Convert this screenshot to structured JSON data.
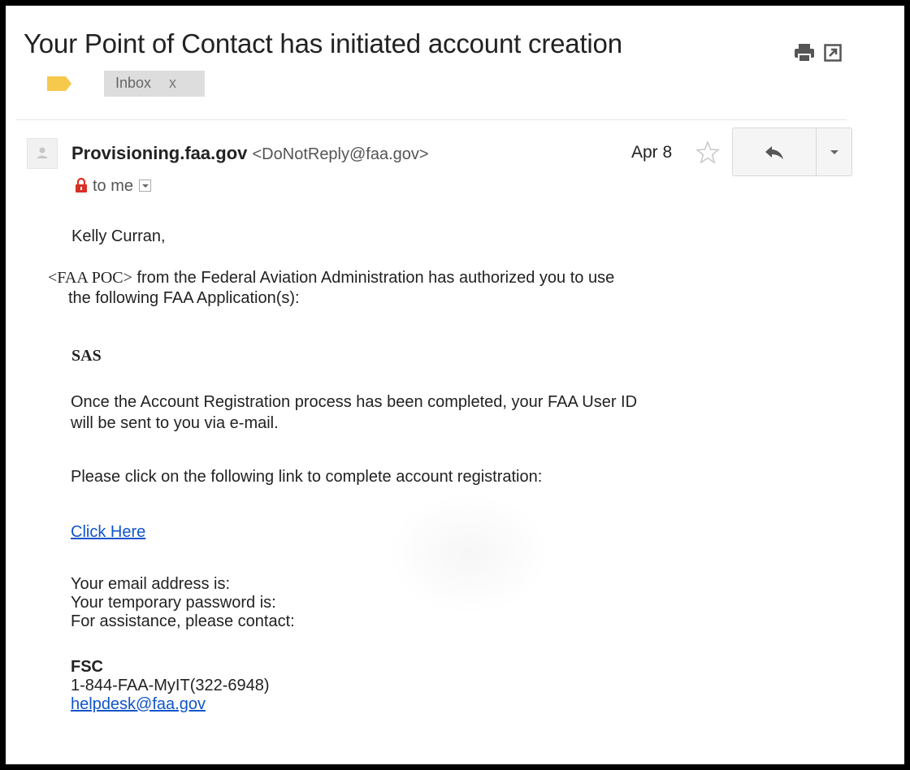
{
  "header": {
    "subject": "Your Point of Contact has initiated account creation",
    "label_chip": "Inbox",
    "label_close": "x",
    "icons": {
      "print": "print-icon",
      "new_window": "new-window-icon",
      "importance": "label-tag-icon"
    },
    "colors": {
      "tag": "#f6c94c"
    }
  },
  "message": {
    "sender_name": "Provisioning.faa.gov",
    "sender_address": "<DoNotReply@faa.gov>",
    "date": "Apr 8",
    "recipient": "to me",
    "icons": {
      "avatar": "avatar-placeholder-icon",
      "star": "star-icon",
      "reply": "reply-icon",
      "more": "chevron-down-icon",
      "lock": "lock-icon"
    },
    "colors": {
      "lock": "#d93025"
    }
  },
  "body": {
    "greeting": "Kelly Curran,",
    "poc_tag": "<FAA POC>",
    "auth_line1": " from the Federal Aviation Administration has authorized you to use",
    "auth_line2": "the following FAA Application(s):",
    "application": "SAS",
    "registration_line1": "Once the Account Registration process has been completed, your FAA User ID",
    "registration_line2": "will be sent to you via e-mail.",
    "click_instruction": "Please click on the following link to complete account registration:",
    "link_text": "Click Here",
    "email_line": "Your email address is:",
    "password_line": "Your temporary password is:",
    "assistance_line": "For assistance, please contact:",
    "contact_name": "FSC",
    "contact_phone": "1-844-FAA-MyIT(322-6948)",
    "contact_email": "helpdesk@faa.gov",
    "colors": {
      "link": "#1155cc"
    }
  }
}
